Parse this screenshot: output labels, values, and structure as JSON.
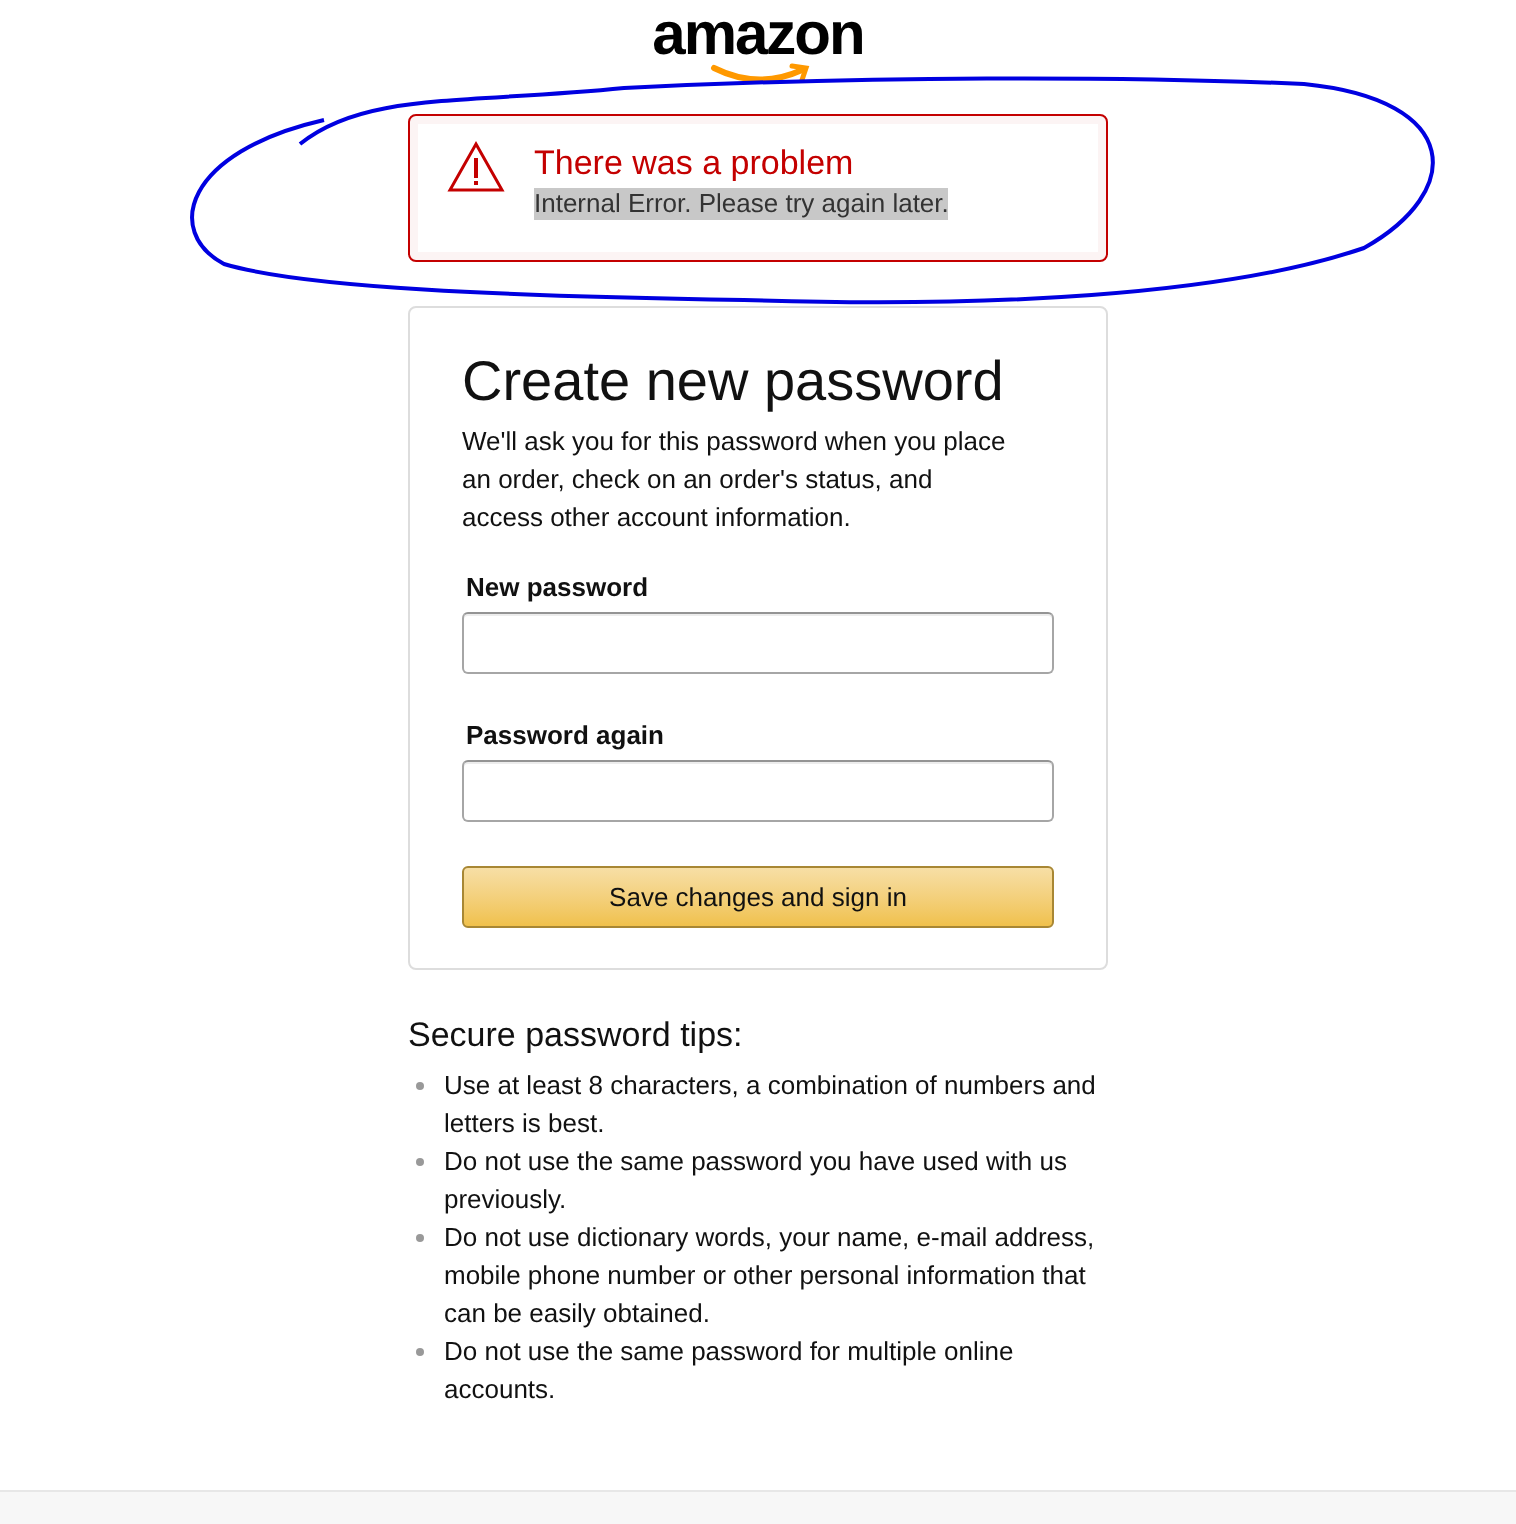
{
  "logo": {
    "text": "amazon"
  },
  "alert": {
    "title": "There was a problem",
    "message": "Internal Error. Please try again later.",
    "message_highlighted": true
  },
  "form": {
    "title": "Create new password",
    "description": "We'll ask you for this password when you place an order, check on an order's status, and access other account information.",
    "fields": [
      {
        "label": "New password"
      },
      {
        "label": "Password again"
      }
    ],
    "submit_button": "Save changes and sign in"
  },
  "tips": {
    "title": "Secure password tips:",
    "items": [
      "Use at least 8 characters, a combination of numbers and letters is best.",
      "Do not use the same password you have used with us previously.",
      "Do not use dictionary words, your name, e-mail address, mobile phone number or other personal information that can be easily obtained.",
      "Do not use the same password for multiple online accounts."
    ]
  }
}
